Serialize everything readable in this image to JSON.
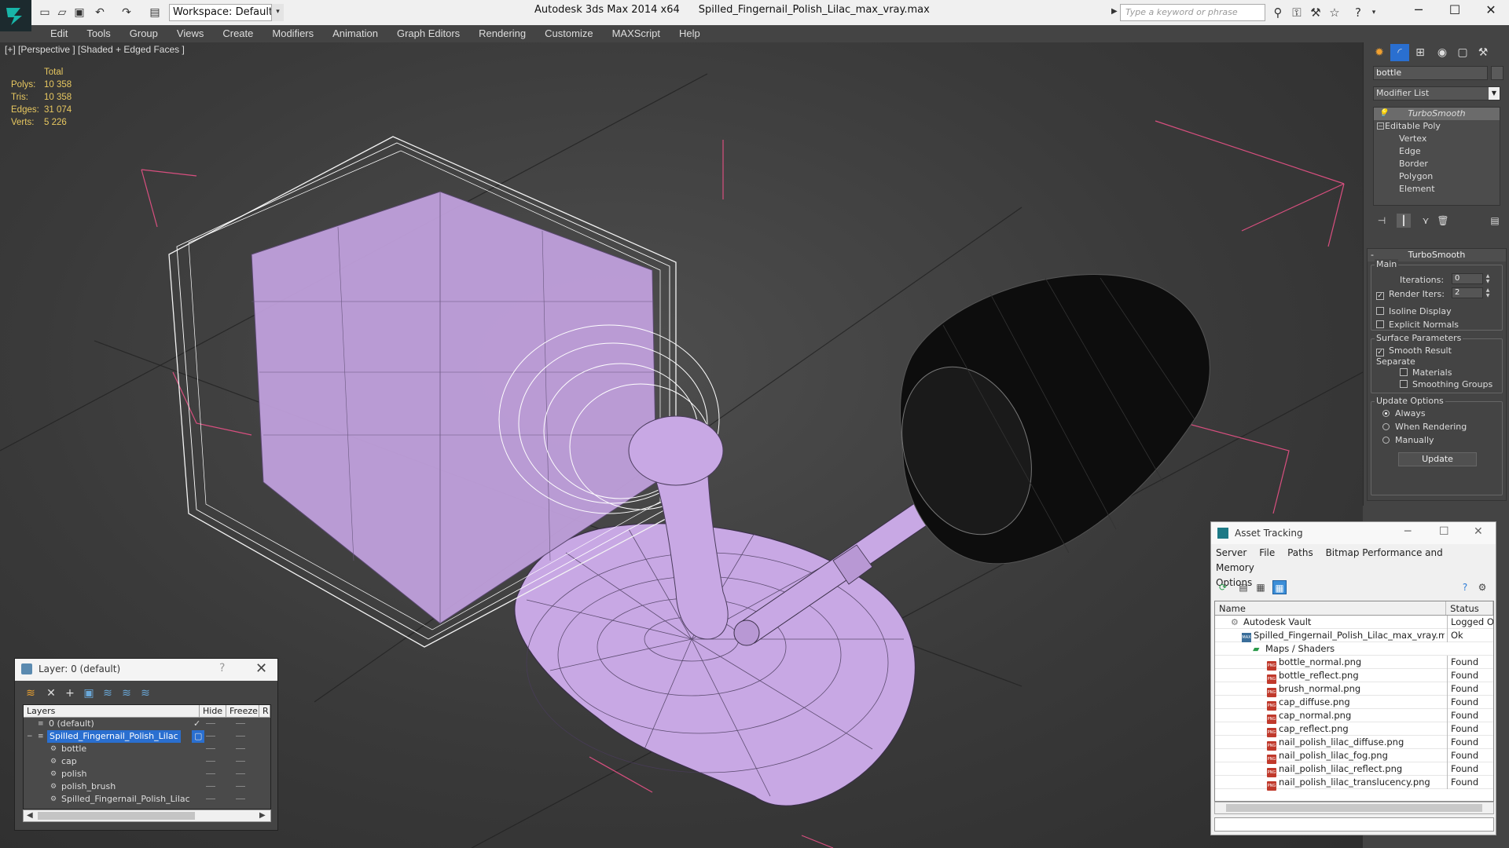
{
  "titlebar": {
    "workspace": "Workspace: Default",
    "app_name": "Autodesk 3ds Max  2014 x64",
    "file_name": "Spilled_Fingernail_Polish_Lilac_max_vray.max",
    "search_placeholder": "Type a keyword or phrase"
  },
  "menu": [
    "Edit",
    "Tools",
    "Group",
    "Views",
    "Create",
    "Modifiers",
    "Animation",
    "Graph Editors",
    "Rendering",
    "Customize",
    "MAXScript",
    "Help"
  ],
  "viewport": {
    "label": "[+] [Perspective ] [Shaded + Edged Faces ]",
    "stats": {
      "header": "Total",
      "rows": [
        {
          "label": "Polys:",
          "value": "10 358"
        },
        {
          "label": "Tris:",
          "value": "10 358"
        },
        {
          "label": "Edges:",
          "value": "31 074"
        },
        {
          "label": "Verts:",
          "value": "5 226"
        }
      ]
    }
  },
  "command_panel": {
    "object_name": "bottle",
    "modifier_list": "Modifier List",
    "stack": {
      "top": "TurboSmooth",
      "base": "Editable Poly",
      "subs": [
        "Vertex",
        "Edge",
        "Border",
        "Polygon",
        "Element"
      ]
    },
    "turbosmooth": {
      "title": "TurboSmooth",
      "main_label": "Main",
      "iterations_label": "Iterations:",
      "iterations_value": "0",
      "render_iters_label": "Render Iters:",
      "render_iters_value": "2",
      "isoline": "Isoline Display",
      "explicit_normals": "Explicit Normals",
      "surface_label": "Surface Parameters",
      "smooth_result": "Smooth Result",
      "separate": "Separate",
      "materials": "Materials",
      "smoothing_groups": "Smoothing Groups",
      "update_label": "Update Options",
      "always": "Always",
      "when_rendering": "When Rendering",
      "manually": "Manually",
      "update_btn": "Update"
    }
  },
  "layer_dialog": {
    "title": "Layer: 0 (default)",
    "help": "?",
    "columns": {
      "layers": "Layers",
      "hide": "Hide",
      "freeze": "Freeze",
      "r": "R"
    },
    "rows": [
      {
        "name": "0 (default)"
      },
      {
        "name": "Spilled_Fingernail_Polish_Lilac"
      },
      {
        "name": "bottle"
      },
      {
        "name": "cap"
      },
      {
        "name": "polish"
      },
      {
        "name": "polish_brush"
      },
      {
        "name": "Spilled_Fingernail_Polish_Lilac"
      }
    ]
  },
  "asset_tracking": {
    "title": "Asset Tracking",
    "menu": [
      "Server",
      "File",
      "Paths",
      "Bitmap Performance and Memory",
      "Options"
    ],
    "columns": {
      "name": "Name",
      "status": "Status"
    },
    "rows": [
      {
        "name": "Autodesk Vault",
        "status": "Logged O"
      },
      {
        "name": "Spilled_Fingernail_Polish_Lilac_max_vray.max",
        "status": "Ok"
      },
      {
        "name": "Maps / Shaders",
        "status": ""
      },
      {
        "name": "bottle_normal.png",
        "status": "Found"
      },
      {
        "name": "bottle_reflect.png",
        "status": "Found"
      },
      {
        "name": "brush_normal.png",
        "status": "Found"
      },
      {
        "name": "cap_diffuse.png",
        "status": "Found"
      },
      {
        "name": "cap_normal.png",
        "status": "Found"
      },
      {
        "name": "cap_reflect.png",
        "status": "Found"
      },
      {
        "name": "nail_polish_lilac_diffuse.png",
        "status": "Found"
      },
      {
        "name": "nail_polish_lilac_fog.png",
        "status": "Found"
      },
      {
        "name": "nail_polish_lilac_reflect.png",
        "status": "Found"
      },
      {
        "name": "nail_polish_lilac_translucency.png",
        "status": "Found"
      }
    ]
  },
  "colors": {
    "stats": "#e8c860",
    "lilac": "#c9a8e0",
    "selection": "#2a6fd0",
    "bounding_box": "#d84f7f"
  }
}
